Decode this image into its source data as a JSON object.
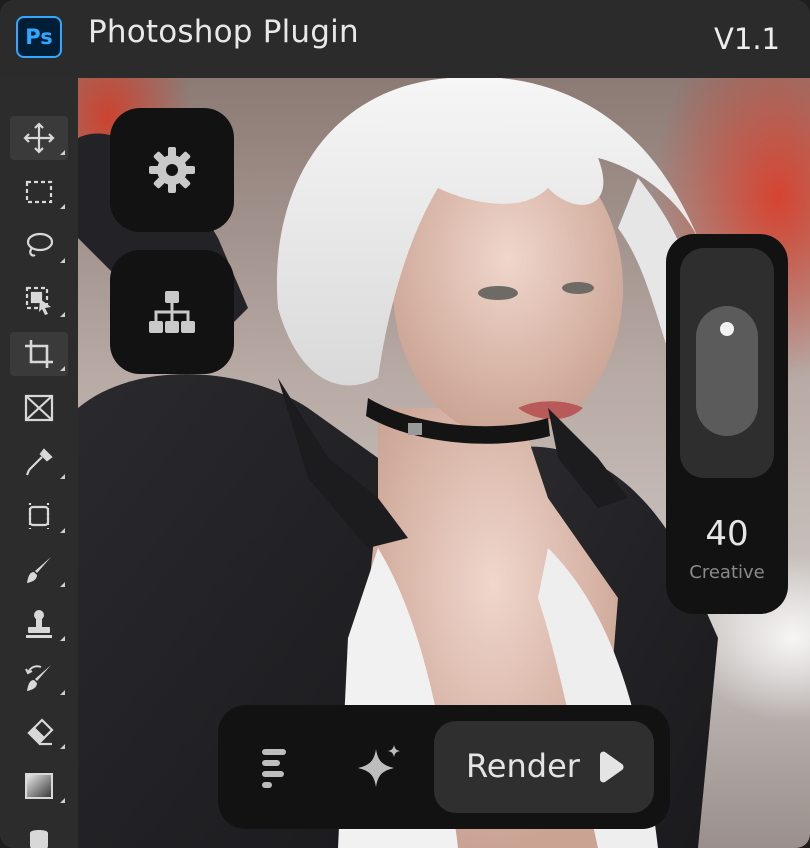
{
  "titlebar": {
    "logo_text": "Ps",
    "title": "Photoshop Plugin",
    "version": "V1.1"
  },
  "toolbar": {
    "tools": [
      {
        "name": "move-tool",
        "icon": "move-icon",
        "active": true
      },
      {
        "name": "marquee-tool",
        "icon": "marquee-icon"
      },
      {
        "name": "lasso-tool",
        "icon": "lasso-icon"
      },
      {
        "name": "object-select-tool",
        "icon": "object-select-icon"
      },
      {
        "name": "crop-tool",
        "icon": "crop-icon",
        "active": true
      },
      {
        "name": "frame-tool",
        "icon": "frame-icon"
      },
      {
        "name": "eyedropper-tool",
        "icon": "eyedropper-icon"
      },
      {
        "name": "healing-tool",
        "icon": "healing-icon"
      },
      {
        "name": "brush-tool",
        "icon": "brush-icon"
      },
      {
        "name": "stamp-tool",
        "icon": "stamp-icon"
      },
      {
        "name": "history-brush-tool",
        "icon": "history-brush-icon"
      },
      {
        "name": "eraser-tool",
        "icon": "eraser-icon"
      },
      {
        "name": "gradient-tool",
        "icon": "gradient-icon"
      },
      {
        "name": "smudge-tool",
        "icon": "smudge-icon"
      }
    ]
  },
  "floating_buttons": {
    "settings_icon": "gear-icon",
    "workflow_icon": "hierarchy-icon"
  },
  "slider": {
    "value": "40",
    "caption": "Creative",
    "level": 0.4
  },
  "bottom_bar": {
    "menu_icon": "menu-lines-icon",
    "sparkle_icon": "sparkle-icon",
    "render_label": "Render",
    "render_icon": "play-icon"
  },
  "colors": {
    "ps_blue": "#31a8ff",
    "panel_dark": "#121212",
    "chrome": "#2b2b2b"
  }
}
